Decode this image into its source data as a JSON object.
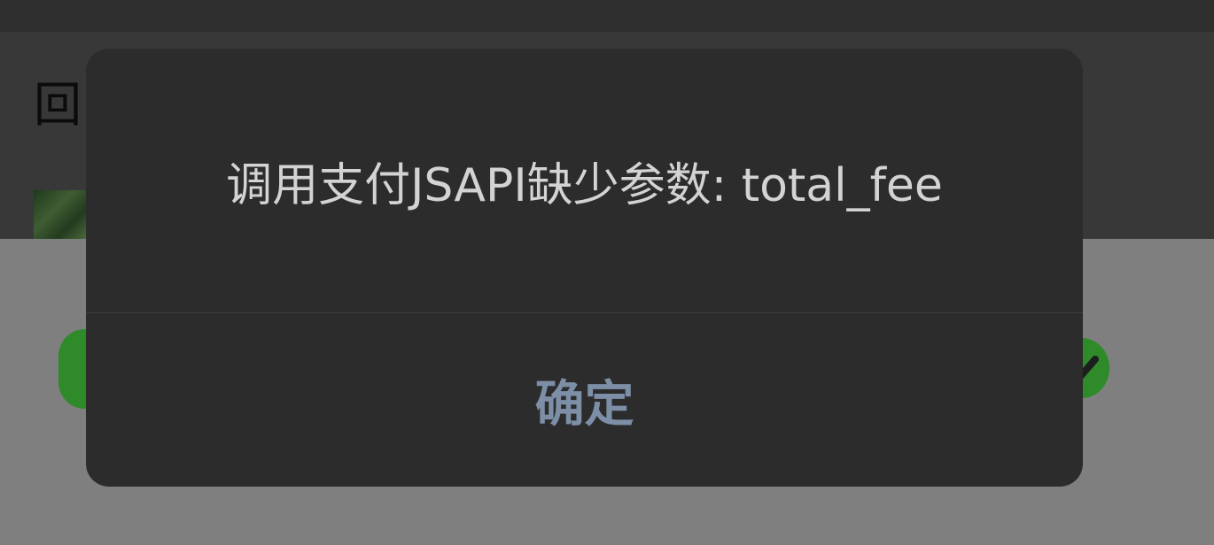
{
  "background": {
    "back_char": "回"
  },
  "dialog": {
    "message": "调用支付JSAPI缺少参数: total_fee",
    "confirm_label": "确定"
  },
  "colors": {
    "dialog_bg": "#2c2c2c",
    "message_text": "#d3d3d3",
    "confirm_text": "#7d8ea7",
    "overlay": "#7f7f7f",
    "wechat_green": "#2f8a2a"
  },
  "icons": {
    "left": "wechat-icon",
    "right": "check-circle-icon"
  }
}
